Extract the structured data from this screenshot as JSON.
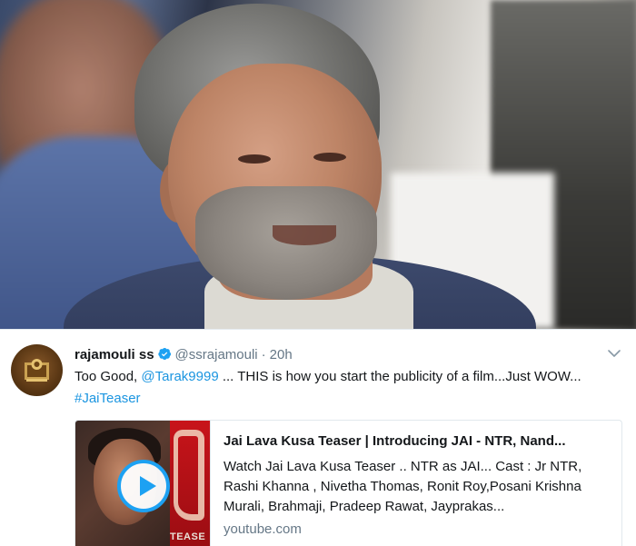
{
  "photo": {
    "subject": "portrait-photo"
  },
  "tweet": {
    "display_name": "rajamouli ss",
    "handle": "@ssrajamouli",
    "separator": "·",
    "time": "20h",
    "text_parts": {
      "p1": "Too Good, ",
      "mention": "@Tarak9999",
      "p2": " ... THIS is how you start the publicity of a film...Just WOW... ",
      "hashtag": "#JaiTeaser"
    },
    "card": {
      "title": "Jai Lava Kusa Teaser | Introducing JAI - NTR, Nand...",
      "description": "Watch Jai Lava Kusa Teaser .. NTR as JAI... Cast : Jr NTR, Rashi Khanna , Nivetha Thomas, Ronit Roy,Posani Krishna Murali, Brahmaji, Pradeep Rawat, Jayprakas...",
      "domain": "youtube.com",
      "thumb_text": "TEASE"
    },
    "icons": {
      "verified": "verified-badge-icon",
      "more": "chevron-down-icon",
      "play": "play-icon"
    },
    "colors": {
      "link": "#1b95e0",
      "verified": "#1da1f2",
      "text": "#14171a",
      "secondary": "#657786"
    }
  }
}
